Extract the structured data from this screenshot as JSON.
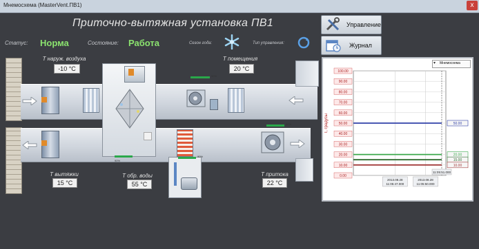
{
  "window": {
    "title": "Мнемосхема (MasterVent.ПВ1)",
    "close_glyph": "x"
  },
  "heading": "Приточно-вытяжная установка ПВ1",
  "status": {
    "status_label": "Статус:",
    "status_value": "Норма",
    "state_label": "Состояние:",
    "state_value": "Работа",
    "season_label": "Сезон года:",
    "control_label": "Тип управления:"
  },
  "buttons": {
    "control": "Управление",
    "journal": "Журнал"
  },
  "sensors": {
    "outdoor": {
      "label": "T наруж. воздуха",
      "value": "-10 °C"
    },
    "room": {
      "label": "T помещения",
      "value": "20 °C"
    },
    "exhaust": {
      "label": "T вытяжки",
      "value": "15 °C"
    },
    "return_water": {
      "label": "T обр. воды",
      "value": "55 °C"
    },
    "supply": {
      "label": "T притока",
      "value": "22 °C"
    }
  },
  "mini_indicators": {
    "exhaust_fan": "90%",
    "supply_fan": "90%",
    "recuperator": "90%",
    "valve": "90%"
  },
  "chart": {
    "dropdown_label": "Мнемосхема",
    "ylabel": "T, градусы",
    "y_ticks": [
      "100.00",
      "90.00",
      "80.00",
      "70.00",
      "60.00",
      "50.00",
      "40.00",
      "30.00",
      "20.00",
      "10.00",
      "0.00"
    ],
    "x_ticks": [
      "2013.08.28\n11:05:47.000",
      "2013.08.28\n11:05:50.000"
    ],
    "right_labels": [
      "50.00",
      "20.00",
      "15.00",
      "10.00"
    ],
    "cursor_time": "11:05:51.000"
  },
  "chart_data": {
    "type": "line",
    "ylabel": "T, градусы",
    "ylim": [
      0,
      100
    ],
    "x": [
      "2013.08.28 11:05:47.000",
      "2013.08.28 11:05:50.000"
    ],
    "series": [
      {
        "values": [
          50,
          50
        ],
        "color": "#2f3fa8"
      },
      {
        "values": [
          20,
          20
        ],
        "color": "#3aa84a"
      },
      {
        "values": [
          15,
          15
        ],
        "color": "#2e6b2e"
      },
      {
        "values": [
          10,
          10
        ],
        "color": "#a23a3a"
      }
    ],
    "grid": true
  },
  "colors": {
    "status_ok": "#8be36f",
    "background": "#3b3d42"
  },
  "icons": {
    "season": "snowflake-icon",
    "control_type": "refresh-icon",
    "control_button": "tools-icon",
    "journal_button": "calendar-icon"
  }
}
